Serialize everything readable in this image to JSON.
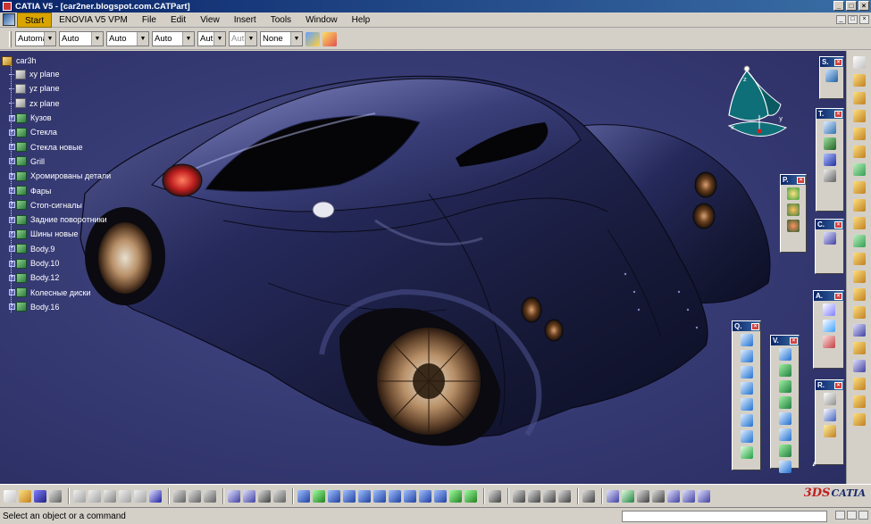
{
  "window": {
    "title": "CATIA V5 - [car2ner.blogspot.com.CATPart]",
    "controls": [
      "_",
      "□",
      "×"
    ]
  },
  "menubar": {
    "items": [
      "Start",
      "ENOVIA V5 VPM",
      "File",
      "Edit",
      "View",
      "Insert",
      "Tools",
      "Window",
      "Help"
    ],
    "active": "Start",
    "doc_controls": [
      "_",
      "□",
      "×"
    ]
  },
  "toolbar": {
    "combos": [
      {
        "name": "layer",
        "value": "Automa"
      },
      {
        "name": "color",
        "value": "Auto"
      },
      {
        "name": "transparency",
        "value": "Auto"
      },
      {
        "name": "line-thickness",
        "value": "Auto"
      },
      {
        "name": "line-type",
        "value": "Aut"
      },
      {
        "name": "point-type",
        "value": "Aut",
        "disabled": true
      },
      {
        "name": "render-style",
        "value": "None"
      }
    ]
  },
  "tree": {
    "root": "car3h",
    "items": [
      {
        "label": "xy plane",
        "icon": "plane-icon"
      },
      {
        "label": "yz plane",
        "icon": "plane-icon"
      },
      {
        "label": "zx plane",
        "icon": "plane-icon"
      },
      {
        "label": "Кузов",
        "icon": "body-icon"
      },
      {
        "label": "Стекла",
        "icon": "body-icon"
      },
      {
        "label": "Стекла новые",
        "icon": "body-icon"
      },
      {
        "label": "Grill",
        "icon": "body-icon"
      },
      {
        "label": "Хромированы детали",
        "icon": "body-icon"
      },
      {
        "label": "Фары",
        "icon": "body-icon"
      },
      {
        "label": "Стоп-сигналы",
        "icon": "body-icon"
      },
      {
        "label": "Задние поворотники",
        "icon": "body-icon"
      },
      {
        "label": "Шины новые",
        "icon": "body-icon"
      },
      {
        "label": "Body.9",
        "icon": "body-icon"
      },
      {
        "label": "Body.10",
        "icon": "body-icon"
      },
      {
        "label": "Body.12",
        "icon": "body-icon"
      },
      {
        "label": "Колесные диски",
        "icon": "body-icon"
      },
      {
        "label": "Body.16",
        "icon": "body-icon"
      }
    ]
  },
  "compass": {
    "x_label": "x",
    "y_label": "y",
    "z_label": "z"
  },
  "float_toolbars": [
    {
      "id": "sketcher",
      "title": "S.",
      "icons": 1
    },
    {
      "id": "tools",
      "title": "T.",
      "icons": 4
    },
    {
      "id": "product",
      "title": "P.",
      "icons": 3
    },
    {
      "id": "constraints",
      "title": "C.",
      "icons": 1
    },
    {
      "id": "analysis",
      "title": "A.",
      "icons": 3
    },
    {
      "id": "query",
      "title": "Q.",
      "icons": 8
    },
    {
      "id": "view",
      "title": "V.",
      "icons": 8
    },
    {
      "id": "refine",
      "title": "R.",
      "icons": 3
    }
  ],
  "statusbar": {
    "message": "Select an object or a command",
    "command_input": ""
  },
  "branding": {
    "logo_prefix": "3DS",
    "logo_text": "CATIA"
  },
  "colors": {
    "viewport_bg": "#363a73",
    "car_body": "#1c1f4a",
    "title_bar": "#0a246a",
    "menu_active": "#d9a400"
  }
}
